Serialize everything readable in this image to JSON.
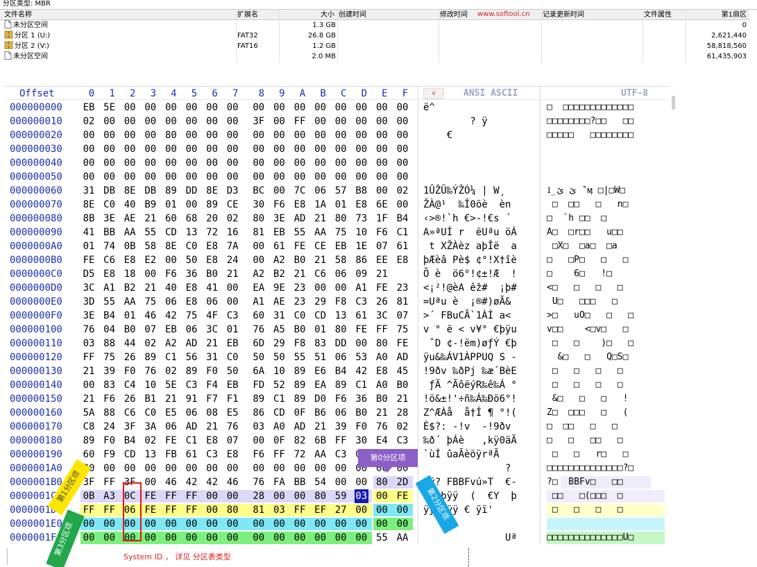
{
  "partition_type_label": "分区类型: MBR",
  "watermark": "www.softool.cn",
  "table": {
    "headers": {
      "name": "文件名称",
      "ext": "扩展名",
      "size": "大小",
      "ctime": "创建时间",
      "mtime": "修改时间",
      "rtime": "记录更新时间",
      "attr": "文件属性",
      "first_sector": "第1扇区"
    },
    "rows": [
      {
        "name": "未分区空间",
        "ext": "",
        "size": "1.3 GB",
        "first_sector": "0",
        "icon": "unallocated-icon"
      },
      {
        "name": "分区 1 (U:)",
        "ext": "FAT32",
        "size": "26.8 GB",
        "first_sector": "2,621,440",
        "icon": "partition-icon"
      },
      {
        "name": "分区 2 (V:)",
        "ext": "FAT16",
        "size": "1.2 GB",
        "first_sector": "58,818,560",
        "icon": "partition-icon"
      },
      {
        "name": "未分区空间",
        "ext": "",
        "size": "2.0 MB",
        "first_sector": "61,435,903",
        "icon": "unallocated-icon"
      }
    ]
  },
  "hex": {
    "offset_label": "Offset",
    "column_labels": [
      "0",
      "1",
      "2",
      "3",
      "4",
      "5",
      "6",
      "7",
      "8",
      "9",
      "A",
      "B",
      "C",
      "D",
      "E",
      "F"
    ],
    "ansi_label": "ANSI ASCII",
    "utf_label": "UTF-8",
    "dropdown_glyph": "∨",
    "rows": [
      {
        "offset": "000000000",
        "bytes": [
          "EB",
          "5E",
          "00",
          "00",
          "00",
          "00",
          "00",
          "00",
          "00",
          "00",
          "00",
          "00",
          "00",
          "00",
          "00",
          "00"
        ],
        "ansi": "ë^",
        "utf": "□  □□□□□□□□□□□□□"
      },
      {
        "offset": "000000010",
        "bytes": [
          "02",
          "00",
          "00",
          "00",
          "00",
          "00",
          "00",
          "00",
          "3F",
          "00",
          "FF",
          "00",
          "00",
          "00",
          "00",
          "00"
        ],
        "ansi": "        ? ÿ",
        "utf": "□□□□□□□□?□□   □□"
      },
      {
        "offset": "000000020",
        "bytes": [
          "00",
          "00",
          "00",
          "00",
          "80",
          "00",
          "00",
          "00",
          "00",
          "00",
          "00",
          "00",
          "00",
          "00",
          "00",
          "00"
        ],
        "ansi": "    €",
        "utf": "□□□□□   □□□□□□□□"
      },
      {
        "offset": "000000030",
        "bytes": [
          "00",
          "00",
          "00",
          "00",
          "00",
          "00",
          "00",
          "00",
          "00",
          "00",
          "00",
          "00",
          "00",
          "00",
          "00",
          "00"
        ],
        "ansi": "",
        "utf": ""
      },
      {
        "offset": "000000040",
        "bytes": [
          "00",
          "00",
          "00",
          "00",
          "00",
          "00",
          "00",
          "00",
          "00",
          "00",
          "00",
          "00",
          "00",
          "00",
          "00",
          "00"
        ],
        "ansi": "",
        "utf": ""
      },
      {
        "offset": "000000050",
        "bytes": [
          "00",
          "00",
          "00",
          "00",
          "00",
          "00",
          "00",
          "00",
          "00",
          "00",
          "00",
          "00",
          "00",
          "00",
          "00",
          "00"
        ],
        "ansi": "",
        "utf": ""
      },
      {
        "offset": "000000060",
        "bytes": [
          "31",
          "DB",
          "8E",
          "DB",
          "89",
          "DD",
          "8E",
          "D3",
          "BC",
          "00",
          "7C",
          "06",
          "57",
          "B8",
          "00",
          "02"
        ],
        "ansi": "1ÛŽÛ‰ÝŽÓ¼ | W¸",
        "utf": "1ۣ ێ ێ ݉ ӎ □|□W□"
      },
      {
        "offset": "000000070",
        "bytes": [
          "8E",
          "C0",
          "40",
          "B9",
          "01",
          "00",
          "89",
          "CE",
          "30",
          "F6",
          "E8",
          "1A",
          "01",
          "E8",
          "6E",
          "00"
        ],
        "ansi": "ŽÀ@¹  ‰Î0öè  èn",
        "utf": " □  □□   □   n□"
      },
      {
        "offset": "000000080",
        "bytes": [
          "8B",
          "3E",
          "AE",
          "21",
          "60",
          "68",
          "20",
          "02",
          "80",
          "3E",
          "AD",
          "21",
          "80",
          "73",
          "1F",
          "B4"
        ],
        "ansi": "‹>®!`h €>-!€s ´",
        "utf": "□  `h □□  □"
      },
      {
        "offset": "000000090",
        "bytes": [
          "41",
          "BB",
          "AA",
          "55",
          "CD",
          "13",
          "72",
          "16",
          "81",
          "EB",
          "55",
          "AA",
          "75",
          "10",
          "F6",
          "C1"
        ],
        "ansi": "A»ªUÍ r  ëUªu öÁ",
        "utf": "A□  □r□□   u□□"
      },
      {
        "offset": "0000000A0",
        "bytes": [
          "01",
          "74",
          "0B",
          "58",
          "8E",
          "C0",
          "E8",
          "7A",
          "00",
          "61",
          "FE",
          "CE",
          "EB",
          "1E",
          "07",
          "61"
        ],
        "ansi": " t XŽÀèz aþÎë  a",
        "utf": " □X□  □a□  □a"
      },
      {
        "offset": "0000000B0",
        "bytes": [
          "FE",
          "C6",
          "E8",
          "E2",
          "00",
          "50",
          "E8",
          "24",
          "00",
          "A2",
          "B0",
          "21",
          "58",
          "86",
          "EE",
          "E8"
        ],
        "ansi": "þÆèâ Pè$ ¢°!X†îè",
        "utf": "□   □P□   □   □"
      },
      {
        "offset": "0000000C0",
        "bytes": [
          "D5",
          "E8",
          "18",
          "00",
          "F6",
          "36",
          "B0",
          "21",
          "A2",
          "B2",
          "21",
          "C6",
          "06",
          "09",
          "21"
        ],
        "ansi": "Õ è  ö6°!¢±!Æ  !",
        "utf": "□    6□   !□"
      },
      {
        "offset": "0000000D0",
        "bytes": [
          "3C",
          "A1",
          "B2",
          "21",
          "40",
          "E8",
          "41",
          "00",
          "EA",
          "9E",
          "23",
          "00",
          "00",
          "A1",
          "FE",
          "23"
        ],
        "ansi": "<¡²!@èA êž#  ¡þ#",
        "utf": "<□   □   □   □"
      },
      {
        "offset": "0000000E0",
        "bytes": [
          "3D",
          "55",
          "AA",
          "75",
          "06",
          "E8",
          "06",
          "00",
          "A1",
          "AE",
          "23",
          "29",
          "F8",
          "C3",
          "26",
          "81"
        ],
        "ansi": "=Uªu è  ¡®#)øÃ&",
        "utf": " U□   □□□   □"
      },
      {
        "offset": "0000000F0",
        "bytes": [
          "3E",
          "B4",
          "01",
          "46",
          "42",
          "75",
          "4F",
          "C3",
          "60",
          "31",
          "C0",
          "CD",
          "13",
          "61",
          "3C",
          "07"
        ],
        "ansi": ">´ FBuCÃ`1ÀÍ a<",
        "utf": ">□   uO□   □   □"
      },
      {
        "offset": "000000100",
        "bytes": [
          "76",
          "04",
          "B0",
          "07",
          "EB",
          "06",
          "3C",
          "01",
          "76",
          "A5",
          "B0",
          "01",
          "80",
          "FE",
          "FF",
          "75"
        ],
        "ansi": "v ° ë < v¥° €þÿu",
        "utf": "v□□    <□v□   □"
      },
      {
        "offset": "000000110",
        "bytes": [
          "03",
          "88",
          "44",
          "02",
          "A2",
          "AD",
          "21",
          "EB",
          "6D",
          "29",
          "F8",
          "83",
          "DD",
          "00",
          "80",
          "FE"
        ],
        "ansi": " ˆD ¢-!ëm)øƒÝ €þ",
        "utf": " □   □    )□   □"
      },
      {
        "offset": "000000120",
        "bytes": [
          "FF",
          "75",
          "26",
          "89",
          "C1",
          "56",
          "31",
          "C0",
          "50",
          "50",
          "55",
          "51",
          "06",
          "53",
          "A0",
          "AD"
        ],
        "ansi": "ÿu&‰ÁV1ÀPPUQ S -",
        "utf": "  &□   □   Q□S□"
      },
      {
        "offset": "000000130",
        "bytes": [
          "21",
          "39",
          "F0",
          "76",
          "02",
          "89",
          "F0",
          "50",
          "6A",
          "10",
          "89",
          "E6",
          "B4",
          "42",
          "E8",
          "45"
        ],
        "ansi": "!9ðv ‰ðPj ‰æ´BèE",
        "utf": " □   □   □   □"
      },
      {
        "offset": "000000140",
        "bytes": [
          "00",
          "83",
          "C4",
          "10",
          "5E",
          "C3",
          "F4",
          "EB",
          "FD",
          "52",
          "89",
          "EA",
          "89",
          "C1",
          "A0",
          "B0"
        ],
        "ansi": " ƒÄ ^ÃôëýR‰ê‰Á °",
        "utf": " □   □   □   □"
      },
      {
        "offset": "000000150",
        "bytes": [
          "21",
          "F6",
          "26",
          "B1",
          "21",
          "91",
          "F7",
          "F1",
          "89",
          "C1",
          "89",
          "D0",
          "F6",
          "36",
          "B0",
          "21"
        ],
        "ansi": "!ö&±!'÷ñ‰Á‰Ðö6°!",
        "utf": " &□   □   □   !"
      },
      {
        "offset": "000000160",
        "bytes": [
          "5A",
          "88",
          "C6",
          "C0",
          "E5",
          "06",
          "08",
          "E5",
          "86",
          "CD",
          "0F",
          "B6",
          "06",
          "B0",
          "21",
          "28"
        ],
        "ansi": "Z^ÆÀå  å†Í ¶ °!(",
        "utf": "Z□  □□□   □   ("
      },
      {
        "offset": "000000170",
        "bytes": [
          "C8",
          "24",
          "3F",
          "3A",
          "06",
          "AD",
          "21",
          "76",
          "03",
          "A0",
          "AD",
          "21",
          "39",
          "F0",
          "76",
          "02"
        ],
        "ansi": "È$?: -!v  -!9ðv",
        "utf": "□  □□   □   □"
      },
      {
        "offset": "000000180",
        "bytes": [
          "89",
          "F0",
          "B4",
          "02",
          "FE",
          "C1",
          "E8",
          "07",
          "00",
          "0F",
          "82",
          "6B",
          "FF",
          "30",
          "E4",
          "C3"
        ],
        "ansi": "‰ð´ þÁè   ‚kÿ0äÃ",
        "utf": "□   □   □□   □"
      },
      {
        "offset": "000000190",
        "bytes": [
          "60",
          "F9",
          "CD",
          "13",
          "FB",
          "61",
          "C3",
          "E8",
          "F6",
          "FF",
          "72",
          "AA",
          "C3",
          "00",
          "00",
          "00"
        ],
        "ansi": "`ùÍ ûaÃèöÿrªÃ",
        "utf": " □   □   r□   □"
      },
      {
        "offset": "0000001A0",
        "bytes": [
          "00",
          "00",
          "00",
          "00",
          "00",
          "00",
          "00",
          "00",
          "00",
          "00",
          "00",
          "00",
          "00",
          "00",
          "00",
          "00"
        ],
        "ansi": "              ?",
        "utf": "□□□□□□□□□□□□□□?□"
      },
      {
        "offset": "0000001B0",
        "bytes": [
          "3F",
          "FF",
          "3F",
          "00",
          "46",
          "42",
          "42",
          "46",
          "76",
          "FA",
          "BB",
          "54",
          "00",
          "00",
          "80",
          "2D"
        ],
        "ansi": "?ÿ? FBBFvú»T  €-",
        "utf": "?□  BBFv□   □□"
      },
      {
        "offset": "0000001C0",
        "bytes": [
          "0B",
          "A3",
          "0C",
          "FE",
          "FF",
          "FF",
          "00",
          "00",
          "28",
          "00",
          "00",
          "80",
          "59",
          "03",
          "00",
          "FE"
        ],
        "ansi": " £ þÿÿ  (  €Y  þ",
        "utf": " □□   □(□□□  □"
      },
      {
        "offset": "0000001D0",
        "bytes": [
          "FF",
          "FF",
          "06",
          "FE",
          "FF",
          "FF",
          "00",
          "80",
          "81",
          "03",
          "FF",
          "EF",
          "27",
          "00",
          "00",
          "00"
        ],
        "ansi": "ÿÿ þÿÿ € ÿï'",
        "utf": " □   □   □   □"
      },
      {
        "offset": "0000001E0",
        "bytes": [
          "00",
          "00",
          "00",
          "00",
          "00",
          "00",
          "00",
          "00",
          "00",
          "00",
          "00",
          "00",
          "00",
          "00",
          "00",
          "00"
        ],
        "ansi": "",
        "utf": ""
      },
      {
        "offset": "0000001F0",
        "bytes": [
          "00",
          "00",
          "00",
          "00",
          "00",
          "00",
          "00",
          "00",
          "00",
          "00",
          "00",
          "00",
          "00",
          "00",
          "55",
          "AA"
        ],
        "ansi": "              Uª",
        "utf": "□□□□□□□□□□□□□□U□"
      }
    ]
  },
  "annotations": {
    "entry0": "第0分区项",
    "entry1": "第1分区项",
    "entry2": "第2分区项",
    "entry3": "第3分区项",
    "system_id_note": "System ID ， 详见 分区表类型"
  },
  "colors": {
    "offset_blue": "#1a2fb0",
    "entry0": "#dcd8f8",
    "entry1": "#ffff88",
    "entry2": "#7ee8f4",
    "entry3": "#7cf07c",
    "annotation_red": "#e02020"
  }
}
